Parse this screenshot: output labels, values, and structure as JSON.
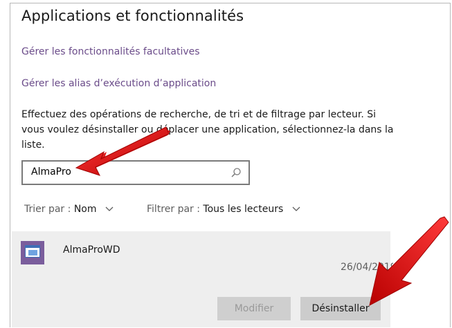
{
  "page": {
    "title": "Applications et fonctionnalités"
  },
  "links": {
    "optional_features": "Gérer les fonctionnalités facultatives",
    "exec_aliases": "Gérer les alias d’exécution d’application"
  },
  "description": "Effectuez des opérations de recherche, de tri et de filtrage par lecteur. Si vous voulez désinstaller ou déplacer une application, sélectionnez-la dans la liste.",
  "search": {
    "value": "AlmaPro",
    "icon": "search-icon"
  },
  "sort": {
    "label": "Trier par : ",
    "value": "Nom"
  },
  "filter": {
    "label": "Filtrer par : ",
    "value": "Tous les lecteurs"
  },
  "app": {
    "name": "AlmaProWD",
    "date": "26/04/2019",
    "modify_label": "Modifier",
    "uninstall_label": "Désinstaller"
  },
  "colors": {
    "link": "#6b4c8a",
    "panel": "#eeeeee",
    "arrow": "#e00000",
    "app_icon": "#7a5d9c"
  }
}
